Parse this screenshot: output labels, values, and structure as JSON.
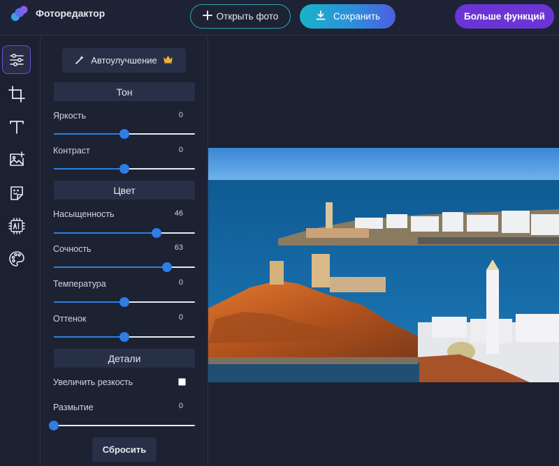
{
  "header": {
    "app_title": "Фоторедактор",
    "open_label": "Открыть фото",
    "save_label": "Сохранить",
    "more_label": "Больше функций"
  },
  "toolbar": {
    "tools": [
      "adjust-icon",
      "crop-icon",
      "text-icon",
      "add-image-icon",
      "sticker-icon",
      "ai-icon",
      "palette-icon"
    ],
    "active_tool": "adjust-icon"
  },
  "panel": {
    "auto_enhance_label": "Автоулучшение",
    "tone": {
      "title": "Тон",
      "brightness": {
        "label": "Яркость",
        "value": "0",
        "fraction": 0.5
      },
      "contrast": {
        "label": "Контраст",
        "value": "0",
        "fraction": 0.5
      }
    },
    "color": {
      "title": "Цвет",
      "saturation": {
        "label": "Насыщенность",
        "value": "46",
        "fraction": 0.73
      },
      "vibrance": {
        "label": "Сочность",
        "value": "63",
        "fraction": 0.8
      },
      "temperature": {
        "label": "Температура",
        "value": "0",
        "fraction": 0.5
      },
      "tint": {
        "label": "Оттенок",
        "value": "0",
        "fraction": 0.5
      }
    },
    "details": {
      "title": "Детали",
      "sharpen": {
        "label": "Увеличить резкость",
        "checked": false
      },
      "blur": {
        "label": "Размытие",
        "value": "0",
        "fraction": 0.0
      }
    },
    "reset_label": "Сбросить"
  },
  "colors": {
    "accent": "#2f7de6",
    "more_button": "#6b35d6",
    "crown": "#f2b233"
  }
}
